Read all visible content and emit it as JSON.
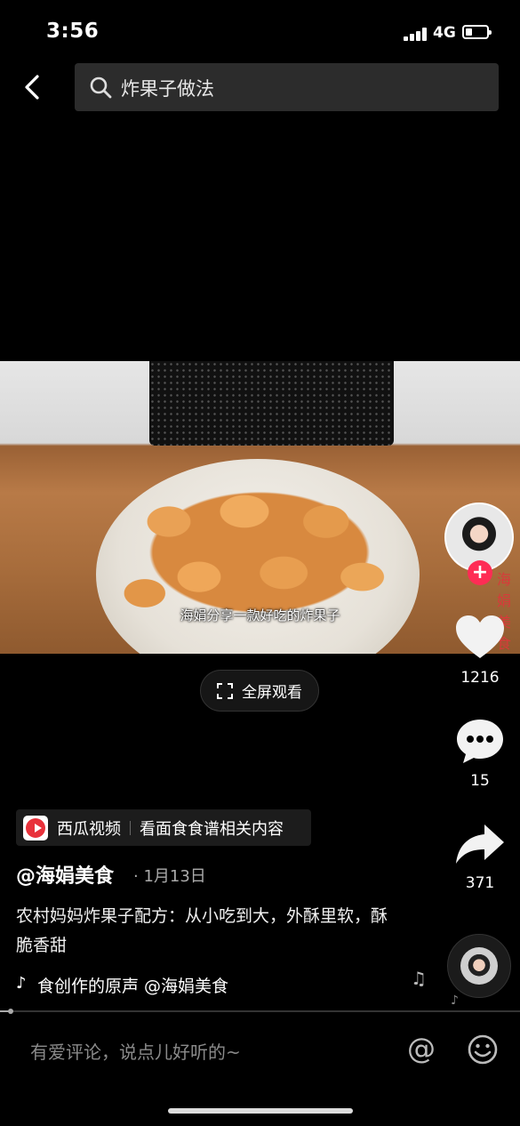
{
  "status_bar": {
    "time": "3:56",
    "network": "4G",
    "battery_level": 0.25
  },
  "search": {
    "query": "炸果子做法"
  },
  "video": {
    "subtitle": "海娟分享一款好吃的炸果子",
    "fullscreen_label": "全屏观看"
  },
  "creator": {
    "watermark": "海娟美食",
    "follow_symbol": "+"
  },
  "actions": {
    "likes": "1216",
    "comments": "15",
    "shares": "371"
  },
  "xigua": {
    "name": "西瓜视频",
    "link": "看面食食谱相关内容"
  },
  "post": {
    "author": "@海娟美食",
    "date": "· 1月13日",
    "description": "农村妈妈炸果子配方：从小吃到大，外酥里软，酥脆香甜",
    "music": "食创作的原声   @海娟美食",
    "progress": 0.02
  },
  "comment_bar": {
    "placeholder": "有爱评论，说点儿好听的~",
    "at_symbol": "@"
  },
  "icons": [
    "back-icon",
    "search-icon",
    "fullscreen-icon",
    "like-icon",
    "comment-icon",
    "share-icon",
    "music-note-icon",
    "tiktok-icon",
    "emoji-icon"
  ],
  "colors": {
    "background": "#000000",
    "follow_accent": "#fe2c55",
    "xigua_red": "#e8323b"
  }
}
